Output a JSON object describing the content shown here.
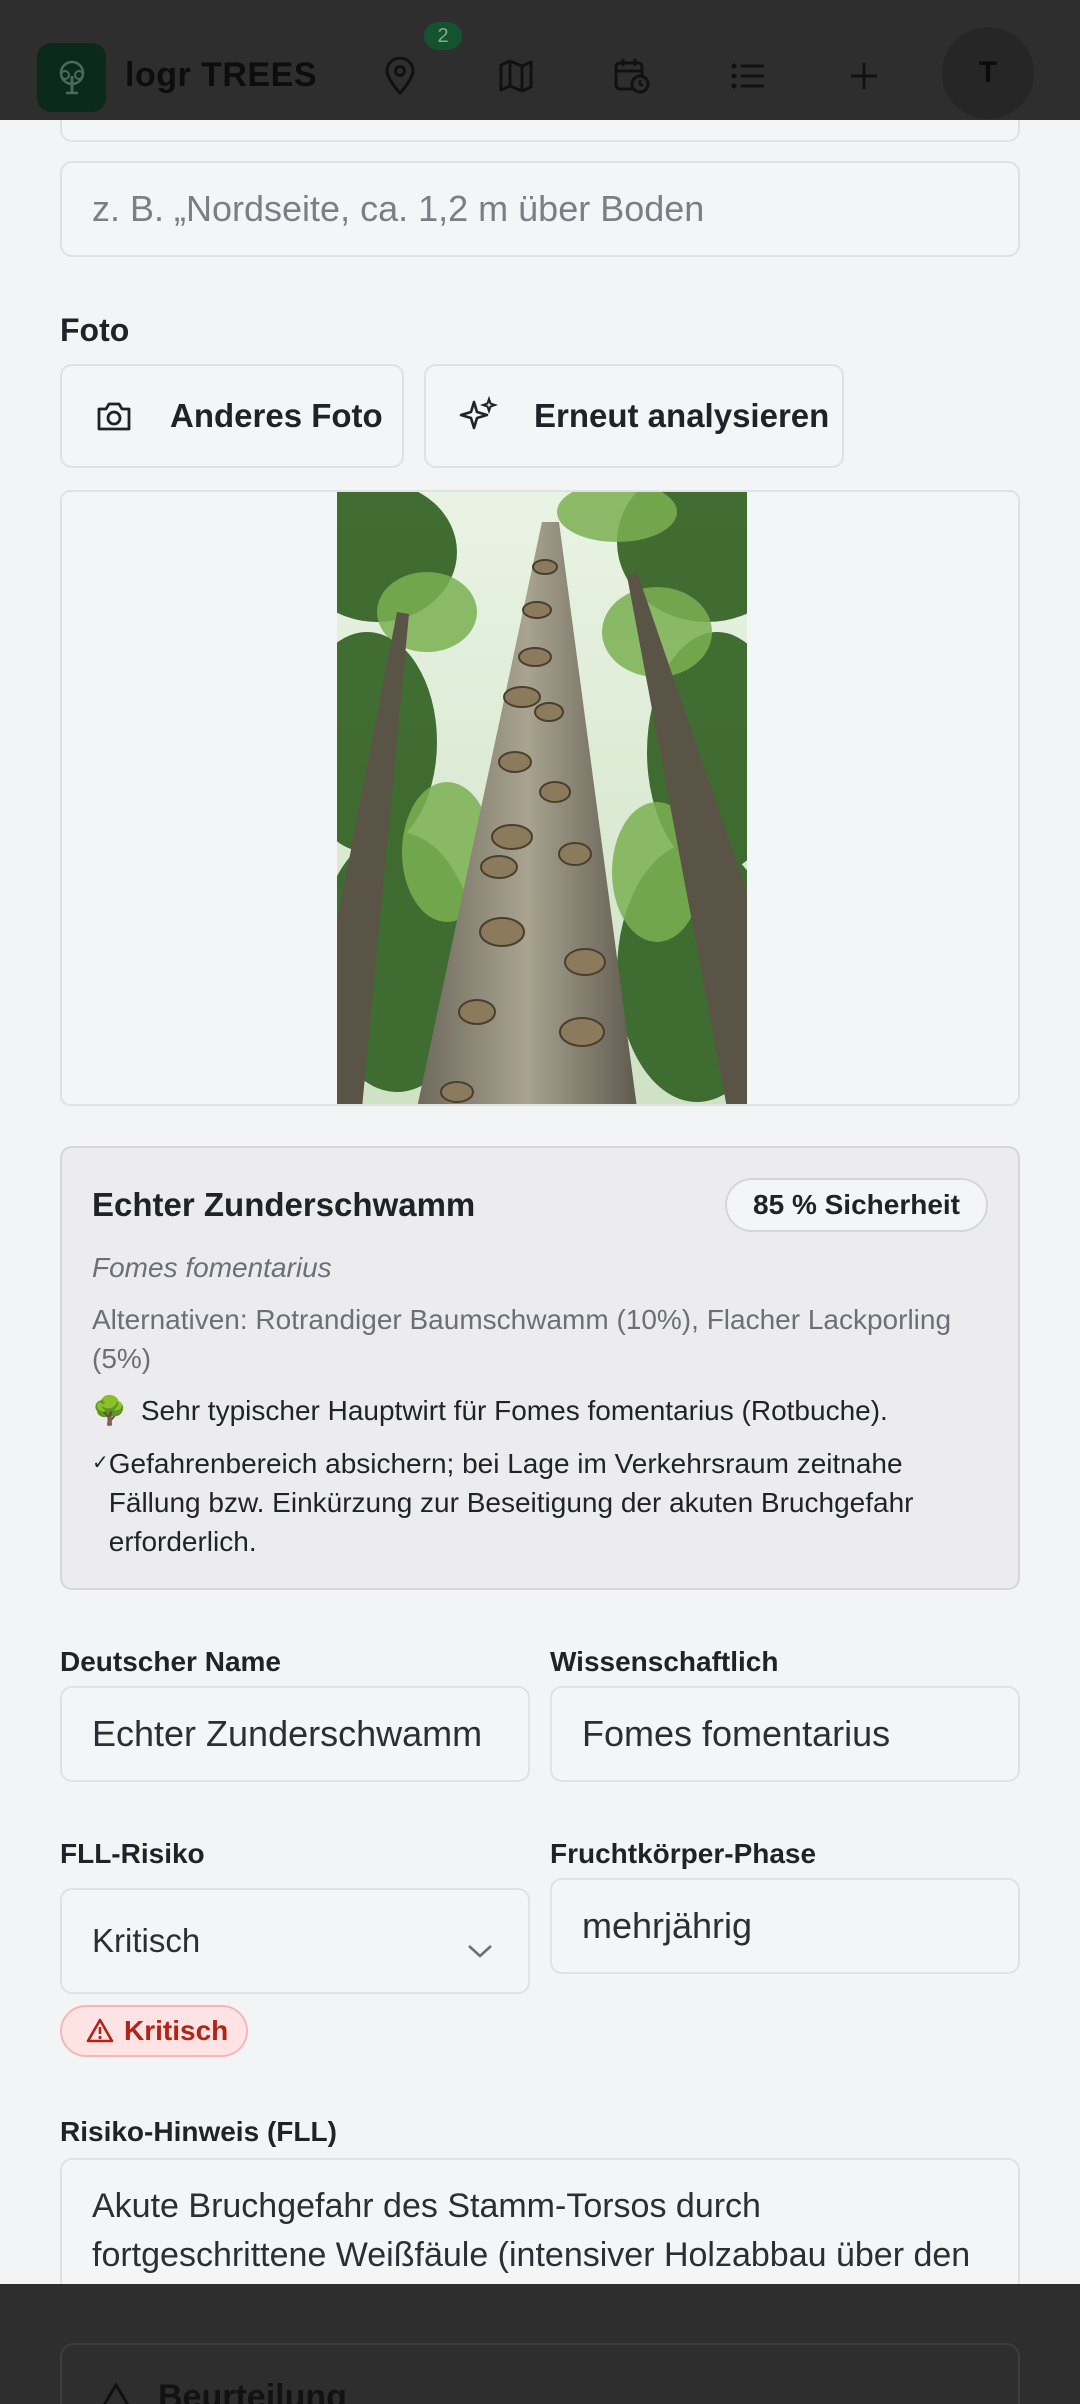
{
  "app": {
    "brand": "logr TREES",
    "badge_count": "2",
    "avatar_initial": "T"
  },
  "location": {
    "placeholder": "z. B. „Nordseite, ca. 1,2 m über Boden"
  },
  "photo": {
    "section_label": "Foto",
    "change_button": "Anderes Foto",
    "reanalyze_button": "Erneut analysieren"
  },
  "result": {
    "name": "Echter Zunderschwamm",
    "confidence": "85 % Sicherheit",
    "scientific": "Fomes fomentarius",
    "alternatives": "Alternativen: Rotrandiger Baumschwamm (10%), Flacher Lackporling (5%)",
    "host_emoji": "🌳",
    "host_note": "Sehr typischer Hauptwirt für Fomes fomentarius (Rotbuche).",
    "recommendation": "Gefahrenbereich absichern; bei Lage im Verkehrsraum zeitnahe Fällung bzw. Einkürzung zur Beseitigung der akuten Bruchgefahr erforderlich."
  },
  "form": {
    "german_name_label": "Deutscher Name",
    "german_name_value": "Echter Zunderschwamm",
    "scientific_label": "Wissenschaftlich",
    "scientific_value": "Fomes fomentarius",
    "risk_label": "FLL-Risiko",
    "risk_value": "Kritisch",
    "phase_label": "Fruchtkörper-Phase",
    "phase_value": "mehrjährig",
    "risk_pill": "Kritisch",
    "risk_note_label": "Risiko-Hinweis (FLL)",
    "risk_note_value": "Akute Bruchgefahr des Stamm-Torsos durch fortgeschrittene Weißfäule (intensiver Holzabbau über den"
  },
  "footer": {
    "section_title": "Beurteilung"
  },
  "colors": {
    "topbar": "#2e2e2e",
    "logo_bg": "#0c2a1c",
    "badge_bg": "#14532d",
    "critical": "#b42318",
    "critical_bg": "#fde3e3"
  }
}
